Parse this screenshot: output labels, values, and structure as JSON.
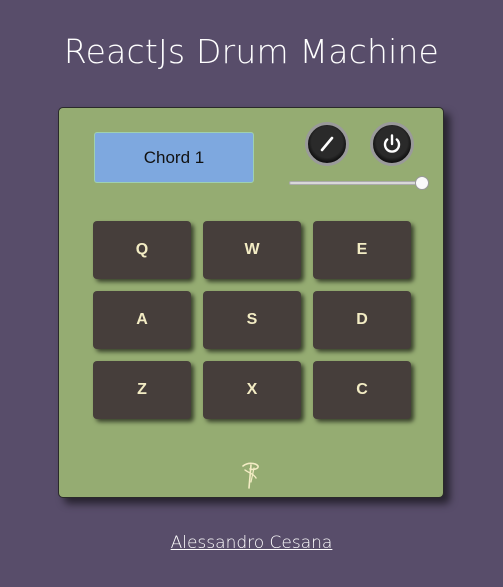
{
  "app": {
    "title": "ReactJs Drum Machine"
  },
  "display": {
    "text": "Chord 1"
  },
  "controls": {
    "volume_knob_icon": "needle-icon",
    "power_icon": "power-icon",
    "volume_level": 1.0
  },
  "pads": [
    "Q",
    "W",
    "E",
    "A",
    "S",
    "D",
    "Z",
    "X",
    "C"
  ],
  "logo_icon": "freecodecamp-logo-icon",
  "footer": {
    "author": "Alessandro Cesana"
  },
  "colors": {
    "background": "#584d6a",
    "machine": "#95ac72",
    "display": "#7ea8df",
    "pad": "#463e3b",
    "pad_text": "#f3ecc4"
  }
}
